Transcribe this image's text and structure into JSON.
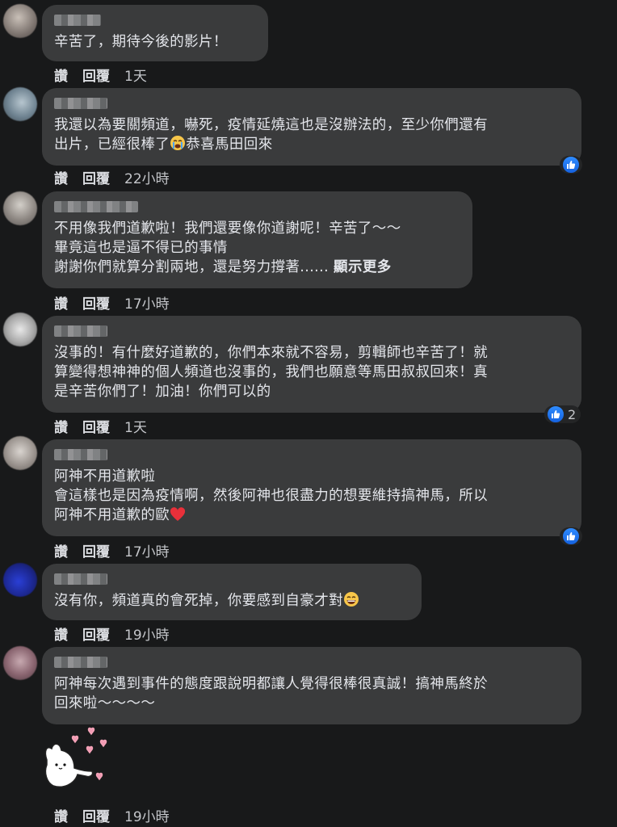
{
  "action_labels": {
    "like": "讚",
    "reply": "回覆"
  },
  "comments": [
    {
      "text": "辛苦了，期待今後的影片！",
      "time": "1天"
    },
    {
      "text": "我還以為要關頻道，嚇死，疫情延燒這也是沒辦法的，至少你們還有\n出片，已經很棒了",
      "text_tail": "恭喜馬田回來",
      "time": "22小時"
    },
    {
      "text": "不用像我們道歉啦！我們還要像你道謝呢！辛苦了～～\n畢竟這也是逼不得已的事情\n謝謝你們就算分割兩地，還是努力撐著......",
      "more": "顯示更多",
      "time": "17小時"
    },
    {
      "text": "沒事的！有什麼好道歉的，你們本來就不容易，剪輯師也辛苦了！就\n算變得想神神的個人頻道也沒事的，我們也願意等馬田叔叔回來！真\n是辛苦你們了！加油！你們可以的",
      "time": "1天",
      "like_count": "2"
    },
    {
      "text": "阿神不用道歉啦\n會這樣也是因為疫情啊，然後阿神也很盡力的想要維持搞神馬，所以\n阿神不用道歉的歐",
      "time": "17小時"
    },
    {
      "text": "沒有你，頻道真的會死掉，你要感到自豪才對",
      "time": "19小時"
    },
    {
      "text": "阿神每次遇到事件的態度跟說明都讓人覺得很棒很真誠！搞神馬終於\n回來啦～～～～",
      "time": "19小時"
    }
  ],
  "icons": {
    "like_badge": "thumbs-up-icon",
    "sticker": "bunny-hearts-sticker"
  },
  "colors": {
    "background": "#18191a",
    "bubble": "#3a3b3c",
    "like_blue": "#2078f4"
  }
}
